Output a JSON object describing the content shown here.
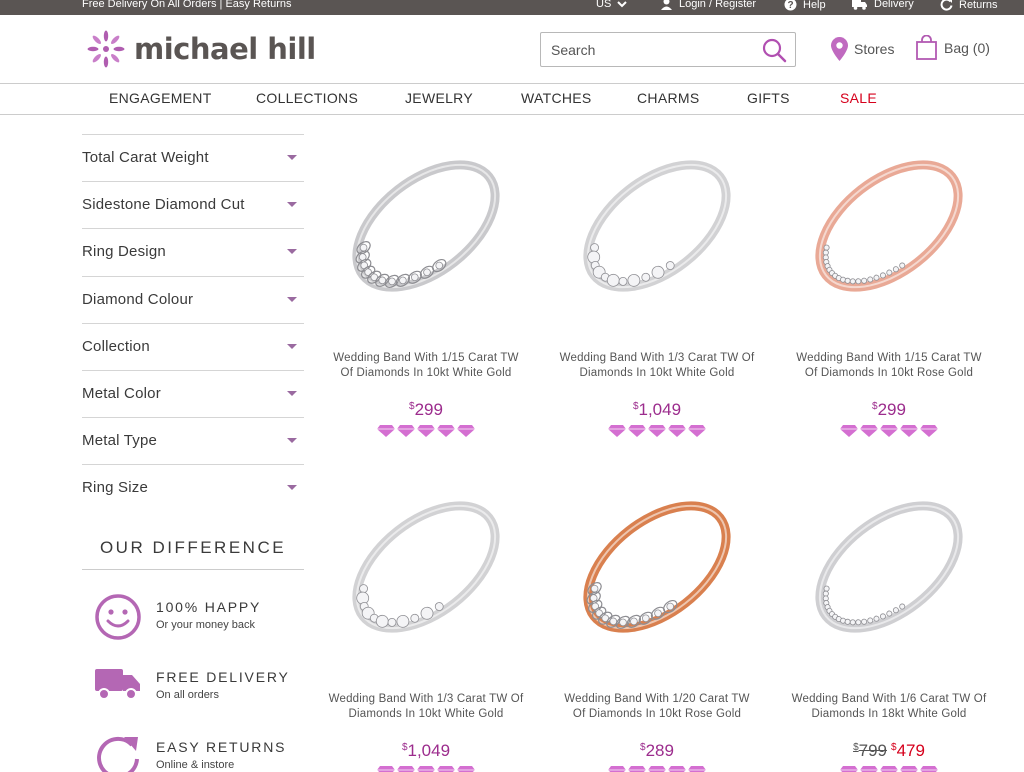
{
  "topbar": {
    "promo": "Free Delivery On All Orders | Easy Returns",
    "country": "US",
    "login": "Login / Register",
    "help": "Help",
    "delivery": "Delivery",
    "returns": "Returns"
  },
  "header": {
    "logo": "michael hill",
    "search_placeholder": "Search",
    "stores": "Stores",
    "bag": "Bag (0)"
  },
  "nav": [
    "ENGAGEMENT",
    "COLLECTIONS",
    "JEWELRY",
    "WATCHES",
    "CHARMS",
    "GIFTS",
    "SALE"
  ],
  "filters": [
    "Total Carat Weight",
    "Sidestone Diamond Cut",
    "Ring Design",
    "Diamond Colour",
    "Collection",
    "Metal Color",
    "Metal Type",
    "Ring Size"
  ],
  "difference": {
    "title": "OUR DIFFERENCE",
    "items": [
      {
        "title": "100% HAPPY",
        "subtitle": "Or your money back",
        "icon": "smiley-icon"
      },
      {
        "title": "FREE DELIVERY",
        "subtitle": "On all orders",
        "icon": "truck-icon"
      },
      {
        "title": "EASY RETURNS",
        "subtitle": "Online & instore",
        "icon": "return-arrow-icon"
      }
    ]
  },
  "products": [
    {
      "name_line1": "Wedding Band With 1/15 Carat TW",
      "name_line2": "Of Diamonds In 10kt White Gold",
      "currency": "$",
      "price": "299",
      "metal": "#c9c9cc",
      "design": "marquise"
    },
    {
      "name_line1": "Wedding Band With 1/3 Carat TW Of",
      "name_line2": "Diamonds In 10kt White Gold",
      "currency": "$",
      "price": "1,049",
      "metal": "#d2d2d4",
      "design": "cluster"
    },
    {
      "name_line1": "Wedding Band With 1/15 Carat TW",
      "name_line2": "Of Diamonds In 10kt Rose Gold",
      "currency": "$",
      "price": "299",
      "metal": "#e9a996",
      "design": "pave"
    },
    {
      "name_line1": "Wedding Band With 1/3 Carat TW Of",
      "name_line2": "Diamonds In 10kt White Gold",
      "currency": "$",
      "price": "1,049",
      "metal": "#d2d2d4",
      "design": "cluster"
    },
    {
      "name_line1": "Wedding Band With 1/20 Carat TW",
      "name_line2": "Of Diamonds In 10kt Rose Gold",
      "currency": "$",
      "price": "289",
      "metal": "#d9804f",
      "design": "marquise"
    },
    {
      "name_line1": "Wedding Band With 1/6 Carat TW Of",
      "name_line2": "Diamonds In 18kt White Gold",
      "currency": "$",
      "old_price": "799",
      "price": "479",
      "metal": "#cfcfd2",
      "design": "pave"
    }
  ],
  "colors": {
    "accent": "#9c2c8d",
    "rating": "#d46fd1",
    "sale": "#d6001c",
    "topbar": "#5a5553"
  },
  "rating_stars": 5
}
